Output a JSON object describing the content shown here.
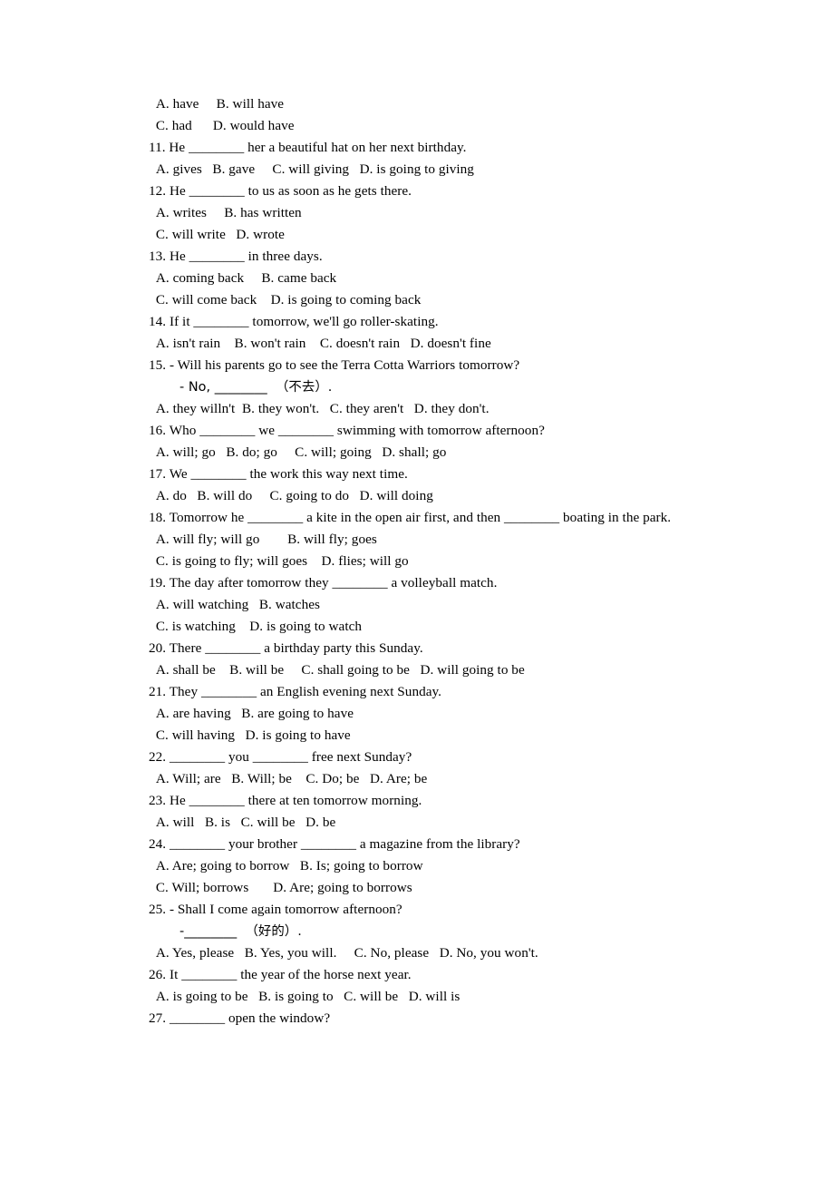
{
  "document": {
    "type": "english-grammar-worksheet",
    "background_color": "#ffffff",
    "text_color": "#000000",
    "lines": [
      {
        "id": "l01",
        "kind": "option",
        "text": " A. have     B. will have"
      },
      {
        "id": "l02",
        "kind": "option",
        "text": " C. had      D. would have"
      },
      {
        "id": "l03",
        "kind": "question",
        "text": "11. He ________ her a beautiful hat on her next birthday."
      },
      {
        "id": "l04",
        "kind": "option",
        "text": " A. gives   B. gave     C. will giving   D. is going to giving"
      },
      {
        "id": "l05",
        "kind": "question",
        "text": "12. He ________ to us as soon as he gets there."
      },
      {
        "id": "l06",
        "kind": "option",
        "text": " A. writes     B. has written"
      },
      {
        "id": "l07",
        "kind": "option",
        "text": " C. will write   D. wrote"
      },
      {
        "id": "l08",
        "kind": "question",
        "text": "13. He ________ in three days."
      },
      {
        "id": "l09",
        "kind": "option",
        "text": " A. coming back     B. came back"
      },
      {
        "id": "l10",
        "kind": "option",
        "text": " C. will come back    D. is going to coming back"
      },
      {
        "id": "l11",
        "kind": "question",
        "text": "14. If it ________ tomorrow, we'll go roller-skating."
      },
      {
        "id": "l12",
        "kind": "option",
        "text": " A. isn't rain    B. won't rain    C. doesn't rain   D. doesn't fine"
      },
      {
        "id": "l13",
        "kind": "question",
        "text": "15. - Will his parents go to see the Terra Cotta Warriors tomorrow?"
      },
      {
        "id": "l14",
        "kind": "sub",
        "text": "- No, ________  （不去）."
      },
      {
        "id": "l15",
        "kind": "option",
        "text": " A. they willn't  B. they won't.   C. they aren't   D. they don't."
      },
      {
        "id": "l16",
        "kind": "question",
        "text": "16. Who ________ we ________ swimming with tomorrow afternoon?"
      },
      {
        "id": "l17",
        "kind": "option",
        "text": " A. will; go   B. do; go     C. will; going   D. shall; go"
      },
      {
        "id": "l18",
        "kind": "question",
        "text": "17. We ________ the work this way next time."
      },
      {
        "id": "l19",
        "kind": "option",
        "text": " A. do   B. will do     C. going to do   D. will doing"
      },
      {
        "id": "l20",
        "kind": "question-wrap",
        "text": "18. Tomorrow he ________ a kite in the open air first, and then ________ boating in the park."
      },
      {
        "id": "l21",
        "kind": "option",
        "text": " A. will fly; will go        B. will fly; goes"
      },
      {
        "id": "l22",
        "kind": "option",
        "text": " C. is going to fly; will goes    D. flies; will go"
      },
      {
        "id": "l23",
        "kind": "question",
        "text": "19. The day after tomorrow they ________ a volleyball match."
      },
      {
        "id": "l24",
        "kind": "option",
        "text": " A. will watching   B. watches"
      },
      {
        "id": "l25",
        "kind": "option",
        "text": " C. is watching    D. is going to watch"
      },
      {
        "id": "l26",
        "kind": "question",
        "text": "20. There ________ a birthday party this Sunday."
      },
      {
        "id": "l27",
        "kind": "option",
        "text": " A. shall be    B. will be     C. shall going to be   D. will going to be"
      },
      {
        "id": "l28",
        "kind": "question",
        "text": "21. They ________ an English evening next Sunday."
      },
      {
        "id": "l29",
        "kind": "option",
        "text": " A. are having   B. are going to have"
      },
      {
        "id": "l30",
        "kind": "option",
        "text": " C. will having   D. is going to have"
      },
      {
        "id": "l31",
        "kind": "question",
        "text": "22. ________ you ________ free next Sunday?"
      },
      {
        "id": "l32",
        "kind": "option",
        "text": " A. Will; are   B. Will; be    C. Do; be   D. Are; be"
      },
      {
        "id": "l33",
        "kind": "question",
        "text": "23. He ________ there at ten tomorrow morning."
      },
      {
        "id": "l34",
        "kind": "option",
        "text": " A. will   B. is   C. will be   D. be"
      },
      {
        "id": "l35",
        "kind": "question",
        "text": "24. ________ your brother ________ a magazine from the library?"
      },
      {
        "id": "l36",
        "kind": "option",
        "text": " A. Are; going to borrow   B. Is; going to borrow"
      },
      {
        "id": "l37",
        "kind": "option",
        "text": " C. Will; borrows       D. Are; going to borrows"
      },
      {
        "id": "l38",
        "kind": "question",
        "text": "25. - Shall I come again tomorrow afternoon?"
      },
      {
        "id": "l39",
        "kind": "sub",
        "text": "-________  （好的）."
      },
      {
        "id": "l40",
        "kind": "option",
        "text": " A. Yes, please   B. Yes, you will.     C. No, please   D. No, you won't."
      },
      {
        "id": "l41",
        "kind": "question",
        "text": "26. It ________ the year of the horse next year."
      },
      {
        "id": "l42",
        "kind": "option",
        "text": " A. is going to be   B. is going to   C. will be   D. will is"
      },
      {
        "id": "l43",
        "kind": "question",
        "text": "27. ________ open the window?"
      }
    ],
    "wrap_line": {
      "part1": "18. Tomorrow he ",
      "blank1": "________",
      "part2": " a kite in the open air first, and then ",
      "blank2": "________",
      "part3": " boating in the park."
    }
  }
}
